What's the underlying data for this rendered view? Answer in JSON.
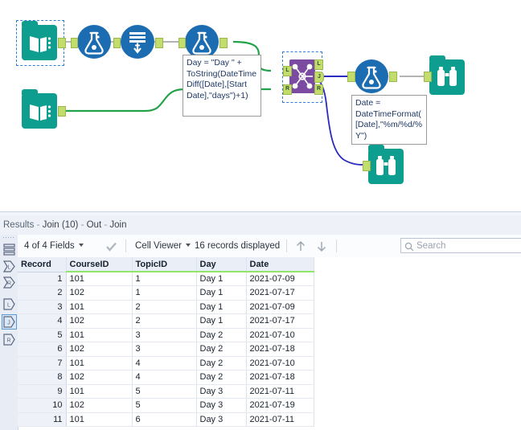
{
  "canvas": {
    "tools": [
      {
        "id": "input-data-1",
        "type": "input-data",
        "label": "Input Data",
        "selected": true
      },
      {
        "id": "formula-1",
        "type": "formula",
        "label": "Formula"
      },
      {
        "id": "generate-rows-1",
        "type": "generate-rows",
        "label": "Generate Rows"
      },
      {
        "id": "formula-2",
        "type": "formula",
        "label": "Formula"
      },
      {
        "id": "input-data-2",
        "type": "input-data",
        "label": "Input Data"
      },
      {
        "id": "join-1",
        "type": "join",
        "label": "Join",
        "selected": true
      },
      {
        "id": "formula-3",
        "type": "formula",
        "label": "Formula"
      },
      {
        "id": "browse-1",
        "type": "browse",
        "label": "Browse"
      },
      {
        "id": "browse-2",
        "type": "browse",
        "label": "Browse"
      }
    ],
    "anchors": {
      "join_inputs": [
        "L",
        "R"
      ],
      "join_outputs": [
        "L",
        "J",
        "R"
      ]
    },
    "annotations": [
      {
        "id": "formula-2-annotation",
        "text": "Day = \"Day \" + ToString(DateTimeDiff([Date],[Start Date],\"days\")+1)"
      },
      {
        "id": "formula-3-annotation",
        "text": "Date = DateTimeFormat([Date],\"%m/%d/%Y\")"
      }
    ],
    "colors": {
      "teal": "#0e9e8f",
      "blue": "#1b6cb0",
      "purple": "#7a4ba0",
      "anchor": "#c3dd6d",
      "connection_green": "#22a34a",
      "connection_blue": "#2b2bbf",
      "connection_gray": "#9a9a9a",
      "selection": "#2e7fd4"
    }
  },
  "results": {
    "title_prefix": "Results",
    "title_tool": "Join (10)",
    "title_anchor_out": "Out",
    "title_anchor_name": "Join",
    "title_sep": "-",
    "toolbar": {
      "fields_label": "4 of 4 Fields",
      "viewer_label": "Cell Viewer",
      "records_label": "16 records displayed",
      "up_arrow": "up-arrow",
      "down_arrow": "down-arrow",
      "checkmark": "checkmark"
    },
    "search": {
      "placeholder": "Search",
      "value": ""
    },
    "rail": {
      "items": [
        {
          "name": "grid-layers-icon",
          "label": "",
          "selected": false
        },
        {
          "name": "input-anchor-l-icon",
          "label": "L",
          "selected": false
        },
        {
          "name": "input-anchor-r-icon",
          "label": "R",
          "selected": false
        },
        {
          "name": "output-anchor-l-icon",
          "label": "L",
          "selected": false
        },
        {
          "name": "output-anchor-j-icon",
          "label": "J",
          "selected": true
        },
        {
          "name": "output-anchor-r-icon",
          "label": "R",
          "selected": false
        }
      ]
    },
    "table": {
      "columns": [
        "Record",
        "CourseID",
        "TopicID",
        "Day",
        "Date"
      ],
      "rows": [
        [
          "1",
          "101",
          "1",
          "Day 1",
          "2021-07-09"
        ],
        [
          "2",
          "102",
          "1",
          "Day 1",
          "2021-07-17"
        ],
        [
          "3",
          "101",
          "2",
          "Day 1",
          "2021-07-09"
        ],
        [
          "4",
          "102",
          "2",
          "Day 1",
          "2021-07-17"
        ],
        [
          "5",
          "101",
          "3",
          "Day 2",
          "2021-07-10"
        ],
        [
          "6",
          "102",
          "3",
          "Day 2",
          "2021-07-18"
        ],
        [
          "7",
          "101",
          "4",
          "Day 2",
          "2021-07-10"
        ],
        [
          "8",
          "102",
          "4",
          "Day 2",
          "2021-07-18"
        ],
        [
          "9",
          "101",
          "5",
          "Day 3",
          "2021-07-11"
        ],
        [
          "10",
          "102",
          "5",
          "Day 3",
          "2021-07-19"
        ],
        [
          "11",
          "101",
          "6",
          "Day 3",
          "2021-07-11"
        ]
      ]
    }
  }
}
